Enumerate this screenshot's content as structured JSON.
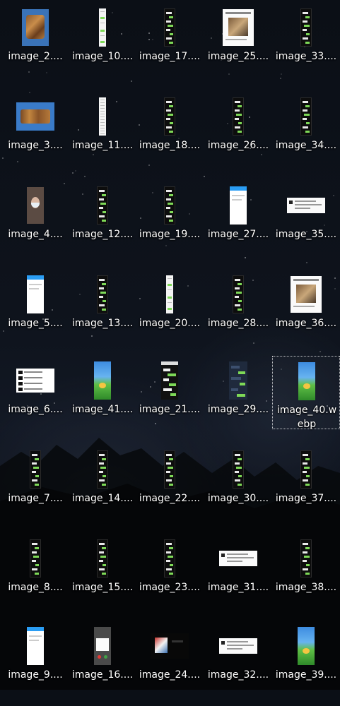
{
  "desktop": {
    "selected_index": 24,
    "items": [
      {
        "label": "image_2....",
        "thumb": "photo-food-icon"
      },
      {
        "label": "image_10....",
        "thumb": "strip-chat-icon"
      },
      {
        "label": "image_17....",
        "thumb": "phone-chat-dark-icon"
      },
      {
        "label": "image_25....",
        "thumb": "white-card-icon"
      },
      {
        "label": "image_33....",
        "thumb": "phone-chat-dark-icon"
      },
      {
        "label": "image_3....",
        "thumb": "food-wide-icon"
      },
      {
        "label": "image_11....",
        "thumb": "strip-list-icon"
      },
      {
        "label": "image_18....",
        "thumb": "phone-chat-dark-icon"
      },
      {
        "label": "image_26....",
        "thumb": "phone-chat-dark-icon"
      },
      {
        "label": "image_34....",
        "thumb": "phone-chat-dark-icon"
      },
      {
        "label": "image_4....",
        "thumb": "selfie-photo-icon"
      },
      {
        "label": "image_12....",
        "thumb": "phone-chat-dark-icon"
      },
      {
        "label": "image_19....",
        "thumb": "phone-chat-dark-icon"
      },
      {
        "label": "image_27....",
        "thumb": "blank-phone-icon"
      },
      {
        "label": "image_35....",
        "thumb": "wide-white-icon"
      },
      {
        "label": "image_5....",
        "thumb": "blank-phone-icon"
      },
      {
        "label": "image_13....",
        "thumb": "phone-chat-dark-icon"
      },
      {
        "label": "image_20....",
        "thumb": "strip-chat-icon"
      },
      {
        "label": "image_28....",
        "thumb": "phone-chat-dark-icon"
      },
      {
        "label": "image_36....",
        "thumb": "white-card-icon"
      },
      {
        "label": "image_6....",
        "thumb": "black-block-list-icon"
      },
      {
        "label": "image_41....",
        "thumb": "game-screen-icon"
      },
      {
        "label": "image_21....",
        "thumb": "chat-mixed-icon"
      },
      {
        "label": "image_29....",
        "thumb": "navy-phone-icon"
      },
      {
        "label": "image_40.webp",
        "thumb": "game-screen-icon"
      },
      {
        "label": "image_7....",
        "thumb": "phone-chat-dark-icon"
      },
      {
        "label": "image_14....",
        "thumb": "phone-chat-dark-icon"
      },
      {
        "label": "image_22....",
        "thumb": "phone-chat-dark-icon"
      },
      {
        "label": "image_30....",
        "thumb": "phone-chat-dark-icon"
      },
      {
        "label": "image_37....",
        "thumb": "phone-chat-dark-icon"
      },
      {
        "label": "image_8....",
        "thumb": "phone-chat-dark-icon"
      },
      {
        "label": "image_15....",
        "thumb": "phone-chat-dark-icon"
      },
      {
        "label": "image_23....",
        "thumb": "phone-chat-dark-icon"
      },
      {
        "label": "image_31....",
        "thumb": "wide-white-icon"
      },
      {
        "label": "image_38....",
        "thumb": "phone-chat-dark-icon"
      },
      {
        "label": "image_9....",
        "thumb": "blank-phone-icon"
      },
      {
        "label": "image_16....",
        "thumb": "gray-phone-icon"
      },
      {
        "label": "image_24....",
        "thumb": "dark-wide-photo-icon"
      },
      {
        "label": "image_32....",
        "thumb": "wide-white-icon"
      },
      {
        "label": "image_39....",
        "thumb": "game-screen-icon"
      }
    ]
  }
}
